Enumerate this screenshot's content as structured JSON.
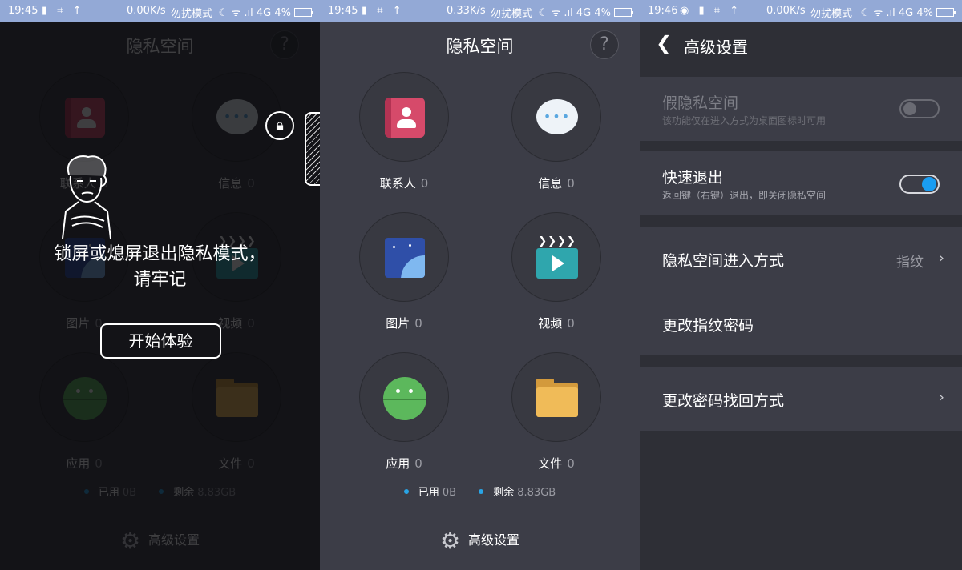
{
  "status_bars": [
    {
      "time": "19:45",
      "icons": "▮ ⌗ ↑",
      "speed": "0.00K/s",
      "dnd": "勿扰模式",
      "right_icons": "☾ ᯤ .ıl 4G 4%"
    },
    {
      "time": "19:45",
      "icons": "▮ ⌗ ↑",
      "speed": "0.33K/s",
      "dnd": "勿扰模式",
      "right_icons": "☾ ᯤ .ıl 4G 4%"
    },
    {
      "time": "19:46",
      "icons": "◉ ▮ ⌗ ↑",
      "speed": "0.00K/s",
      "dnd": "勿扰模式",
      "right_icons": "☾ ᯤ .ıl 4G 4%"
    }
  ],
  "space": {
    "title": "隐私空间",
    "help": "?",
    "tiles": [
      {
        "label": "联系人",
        "count": "0"
      },
      {
        "label": "信息",
        "count": "0"
      },
      {
        "label": "图片",
        "count": "0"
      },
      {
        "label": "视频",
        "count": "0"
      },
      {
        "label": "应用",
        "count": "0"
      },
      {
        "label": "文件",
        "count": "0"
      }
    ],
    "storage": {
      "used_label": "已用",
      "used_value": "0B",
      "free_label": "剩余",
      "free_value": "8.83GB"
    },
    "footer": {
      "label": "高级设置"
    }
  },
  "overlay": {
    "hint_line1": "锁屏或熄屏退出隐私模式，",
    "hint_line2": "请牢记",
    "start_button": "开始体验"
  },
  "settings": {
    "title": "高级设置",
    "fake_space": {
      "title": "假隐私空间",
      "desc": "该功能仅在进入方式为桌面图标时可用",
      "enabled": false
    },
    "quick_exit": {
      "title": "快速退出",
      "desc": "返回键（右键）退出，即关闭隐私空间",
      "enabled": true
    },
    "entry_method": {
      "title": "隐私空间进入方式",
      "value": "指纹"
    },
    "change_fp_password": {
      "title": "更改指纹密码"
    },
    "change_recovery": {
      "title": "更改密码找回方式"
    }
  },
  "colors": {
    "status_bar": "#93a9d6",
    "panel": "#3c3d47",
    "accent": "#1a9df2"
  }
}
